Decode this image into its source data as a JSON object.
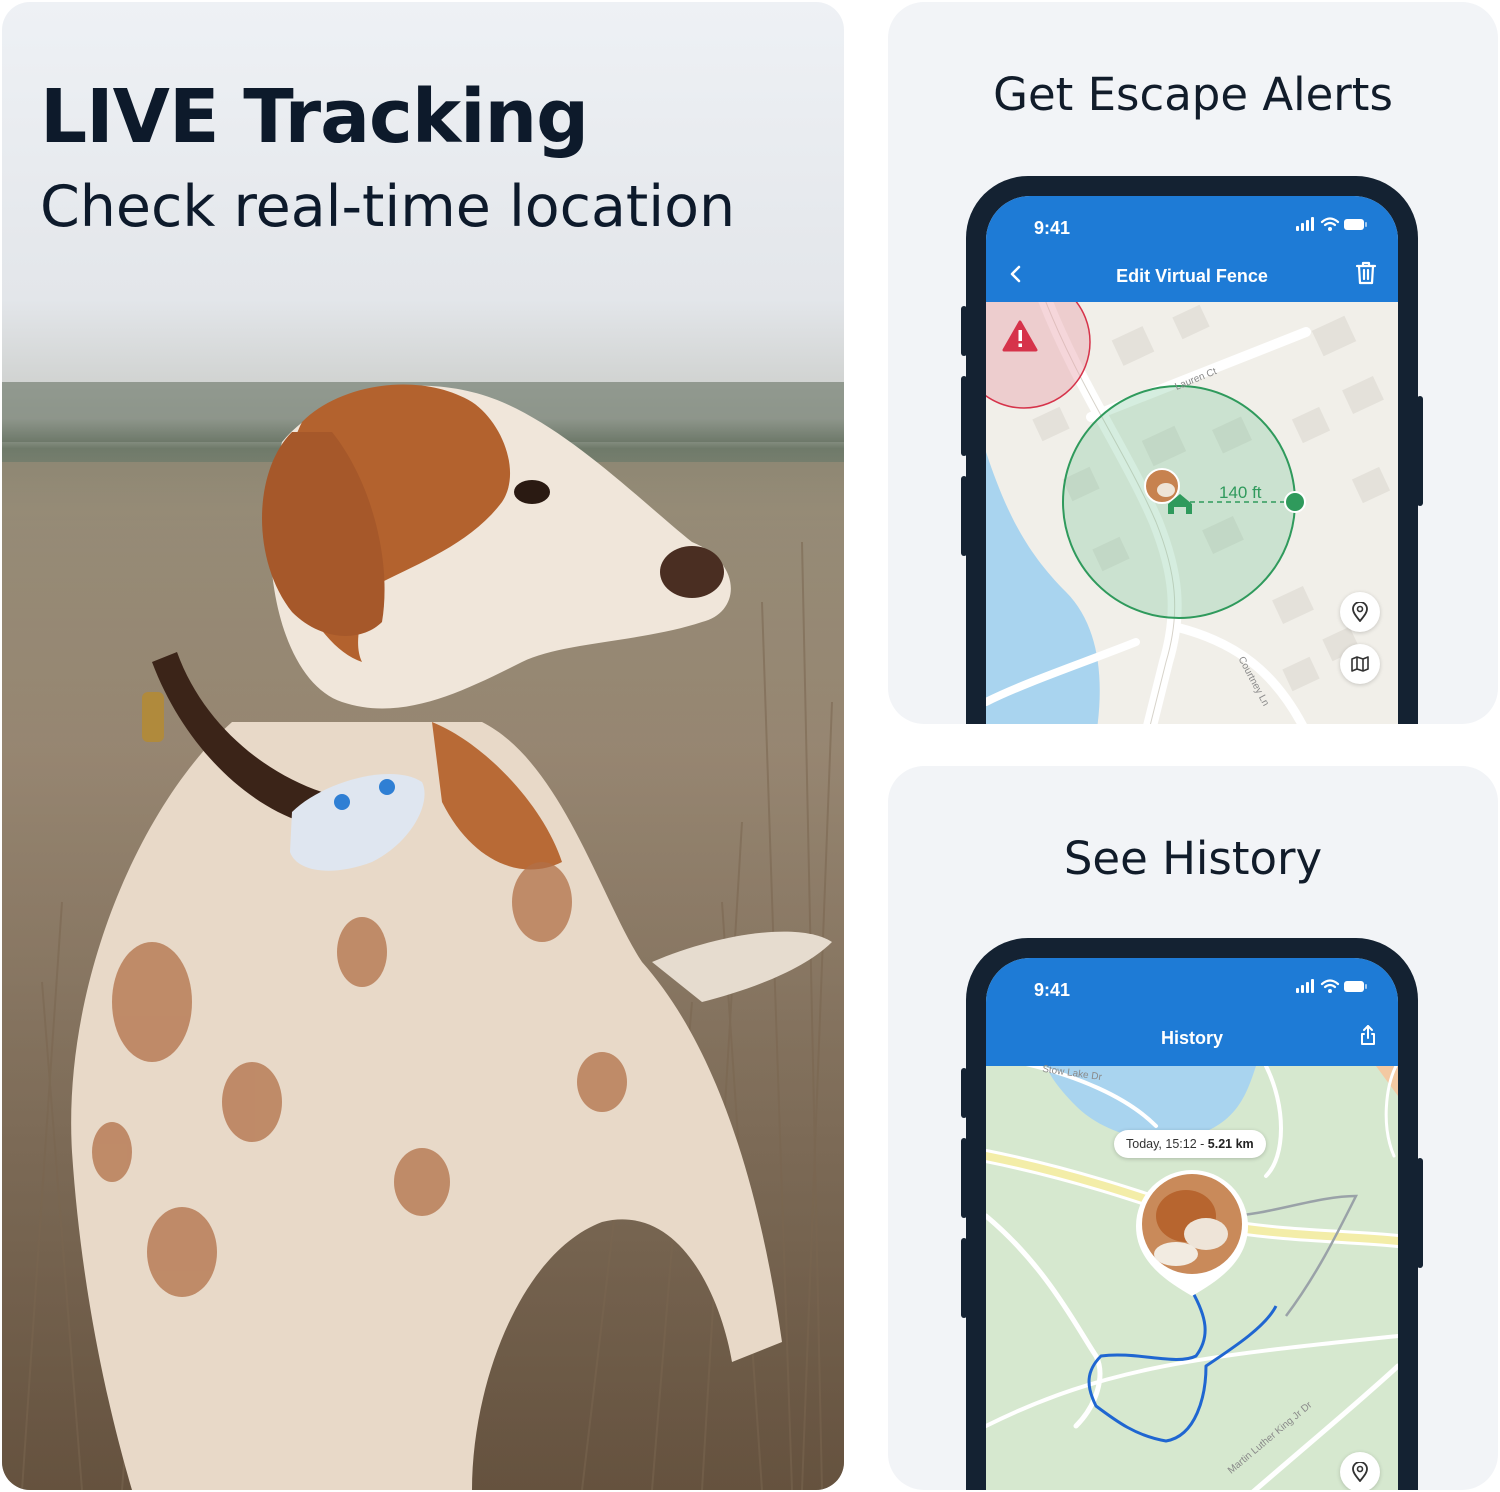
{
  "hero": {
    "title": "LIVE Tracking",
    "subtitle": "Check real-time location"
  },
  "escape_card": {
    "title": "Get Escape Alerts",
    "phone": {
      "time": "9:41",
      "screen_title": "Edit Virtual Fence",
      "distance": "140 ft",
      "streets": [
        "Lauren Ct",
        "Courtney Ln"
      ]
    }
  },
  "history_card": {
    "title": "See History",
    "phone": {
      "time": "9:41",
      "screen_title": "History",
      "summary_prefix": "Today, 15:12 - ",
      "summary_distance": "5.21 km",
      "streets": [
        "Stow Lake Dr",
        "Martin Luther King Jr Dr"
      ]
    }
  },
  "colors": {
    "brand_blue": "#1e7bd6",
    "phone_frame": "#142232",
    "fence_green": "#2f9a5c",
    "alert_red": "#d6334a",
    "route_blue": "#1f66d1"
  },
  "icons": [
    "back-chevron-icon",
    "trash-icon",
    "warning-icon",
    "home-icon",
    "location-pin-icon",
    "map-icon",
    "share-icon",
    "signal-icon",
    "wifi-icon",
    "battery-icon"
  ]
}
